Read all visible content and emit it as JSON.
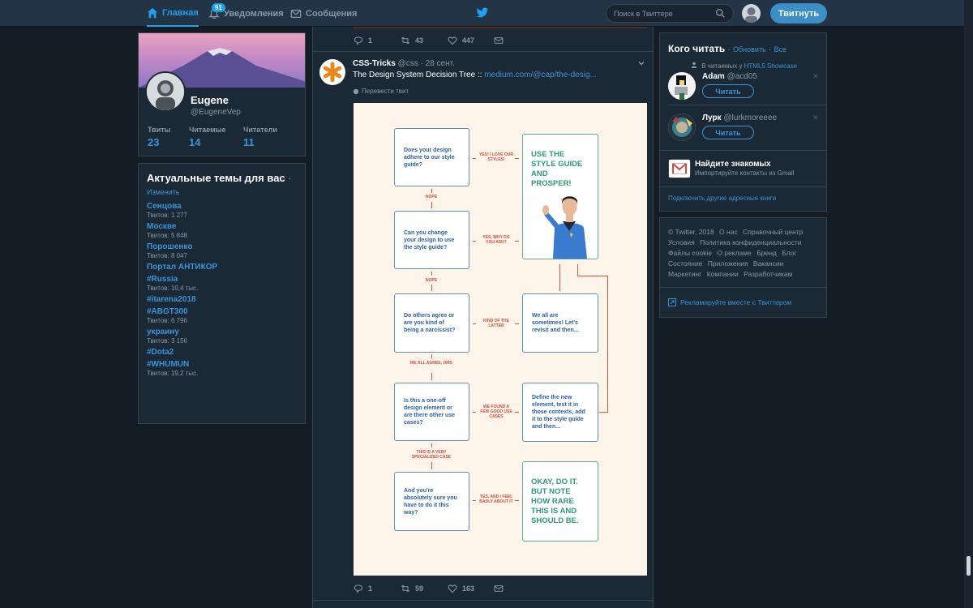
{
  "nav": {
    "home": "Главная",
    "notifications": "Уведомления",
    "notifications_badge": "91",
    "messages": "Сообщения",
    "search_placeholder": "Поиск в Твиттере",
    "tweet_button": "Твитнуть"
  },
  "profile": {
    "name": "Eugene",
    "handle": "@EugeneVep",
    "stats": [
      {
        "label": "Твиты",
        "value": "23"
      },
      {
        "label": "Читаемые",
        "value": "14"
      },
      {
        "label": "Читатели",
        "value": "11"
      }
    ]
  },
  "trends": {
    "title": "Актуальные темы для вас",
    "title_dot": "·",
    "change": "Изменить",
    "items": [
      {
        "name": "Сенцова",
        "count": "Твитов: 1 277"
      },
      {
        "name": "Москве",
        "count": "Твитов: 5 848"
      },
      {
        "name": "Порошенко",
        "count": "Твитов: 8 047"
      },
      {
        "name": "Портал АНТИКОР",
        "count": ""
      },
      {
        "name": "#Russia",
        "count": "Твитов: 10,4 тыс."
      },
      {
        "name": "#itarena2018",
        "count": ""
      },
      {
        "name": "#ABGT300",
        "count": "Твитов: 6 796"
      },
      {
        "name": "украину",
        "count": "Твитов: 3 156"
      },
      {
        "name": "#Dota2",
        "count": ""
      },
      {
        "name": "#WHUMUN",
        "count": "Твитов: 19,2 тыс."
      }
    ]
  },
  "prev_tweet_actions": {
    "reply": "1",
    "retweet": "43",
    "like": "447"
  },
  "tweet": {
    "name": "CSS-Tricks",
    "handle": "@css",
    "date": "· 28 сент.",
    "text": "The Design System Decision Tree ::",
    "link": "medium.com/@cap/the-desig...",
    "translate": "Перевести твит",
    "actions": {
      "reply": "1",
      "retweet": "59",
      "like": "163"
    }
  },
  "flowchart": {
    "questions": [
      "Does your design adhere to our style guide?",
      "Can you change your design to use the style guide?",
      "Do others agree or are you kind of being a narcissist?",
      "Is this a one-off design element or are there other use cases?",
      "And you're absolutely sure you have to do it this way?"
    ],
    "right_labels": [
      "YES! I LOVE OUR STYLES!",
      "YES, WHY DO YOU ASK?",
      "KIND OF THE LATTER",
      "WE FOUND A FEW GOOD USE CASES",
      "YES, AND I FEEL BADLY ABOUT IT"
    ],
    "down_labels": [
      "NOPE",
      "NOPE",
      "WE ALL AGREE, OMG",
      "THIS IS A VERY SPECIALIZED CASE"
    ],
    "outcome_top": "USE THE STYLE GUIDE AND PROSPER!",
    "outcome_mid": "We all are sometimes! Let's revisit and then...",
    "outcome_define": "Define the new element, test it in those contexts, add it to the style guide and then...",
    "outcome_bottom": "OKAY, DO IT. BUT NOTE HOW RARE THIS IS AND SHOULD BE."
  },
  "who_to_follow": {
    "title": "Кого читать",
    "refresh": "Обновить",
    "all": "Все",
    "dot": "·",
    "context_prefix": "В читаемых у",
    "context_user": "HTML5 Showcase",
    "users": [
      {
        "name": "Adam",
        "handle": "@acd05",
        "button": "Читать"
      },
      {
        "name": "Лурк",
        "handle": "@lurkmoreeee",
        "button": "Читать"
      }
    ],
    "find_title": "Найдите знакомых",
    "find_sub": "Импортируйте контакты из Gmail",
    "connect": "Подключить другие адресные книги"
  },
  "footer": {
    "links": [
      "© Twitter, 2018",
      "О нас",
      "Справочный центр",
      "Условия",
      "Политика конфиденциальности",
      "Файлы cookie",
      "О рекламе",
      "Бренд",
      "Блог",
      "Состояние",
      "Приложения",
      "Вакансии",
      "Маркетинг",
      "Компании",
      "Разработчикам"
    ],
    "advertise": "Рекламируйте вместе с Твиттером"
  },
  "colors": {
    "accent": "#1da1f2",
    "background": "#141d26",
    "panel": "#1b2836",
    "link": "#3b94d9"
  }
}
